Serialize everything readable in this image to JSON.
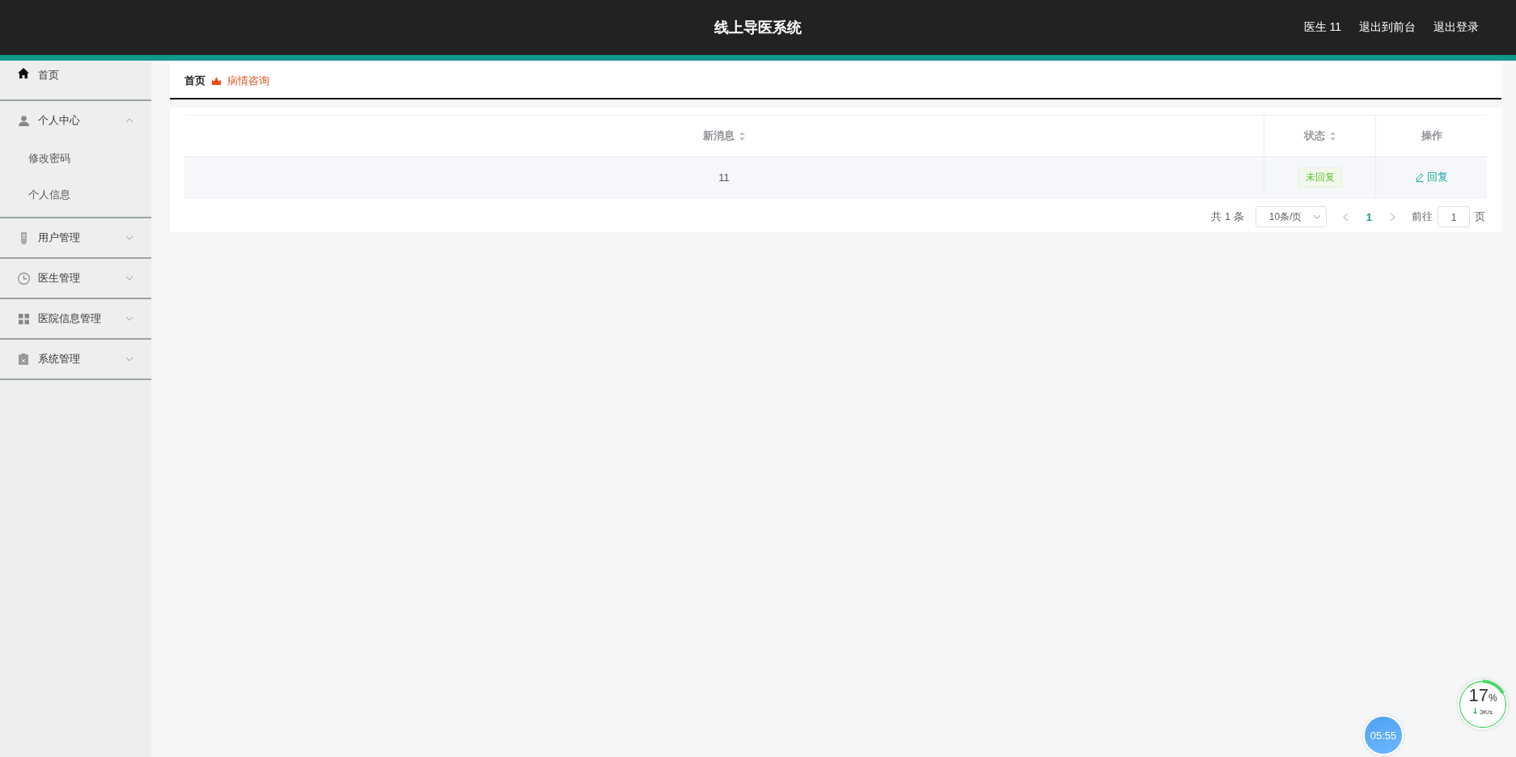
{
  "header": {
    "title": "线上导医系统",
    "links": [
      "医生 11",
      "退出到前台",
      "退出登录"
    ]
  },
  "sidebar": {
    "items": [
      {
        "label": "首页",
        "kind": "home"
      },
      {
        "label": "个人中心",
        "kind": "person",
        "expanded": true,
        "children": [
          {
            "label": "修改密码"
          },
          {
            "label": "个人信息"
          }
        ]
      },
      {
        "label": "用户管理",
        "kind": "device",
        "expanded": false
      },
      {
        "label": "医生管理",
        "kind": "clock",
        "expanded": false
      },
      {
        "label": "医院信息管理",
        "kind": "grid",
        "expanded": false
      },
      {
        "label": "系统管理",
        "kind": "clipboard",
        "expanded": false
      }
    ]
  },
  "breadcrumb": [
    {
      "label": "首页",
      "current": false
    },
    {
      "label": "病情咨询",
      "current": true
    }
  ],
  "table": {
    "columns": [
      {
        "label": "新消息",
        "sortable": true
      },
      {
        "label": "状态",
        "sortable": true
      },
      {
        "label": "操作",
        "sortable": false
      }
    ],
    "rows": [
      {
        "message": "11",
        "status": "未回复",
        "action": "回复"
      }
    ]
  },
  "pagination": {
    "total": "共 1 条",
    "page_size": "10条/页",
    "pages": [
      {
        "label": "1",
        "selected": true
      }
    ],
    "goto_label": "前往",
    "goto_value": "1",
    "goto_suffix": "页"
  },
  "speed_widget": {
    "percent": "17",
    "unit": "%",
    "rate": "3K/s",
    "level": 0.17
  },
  "timer_widget": {
    "time": "05:55"
  }
}
